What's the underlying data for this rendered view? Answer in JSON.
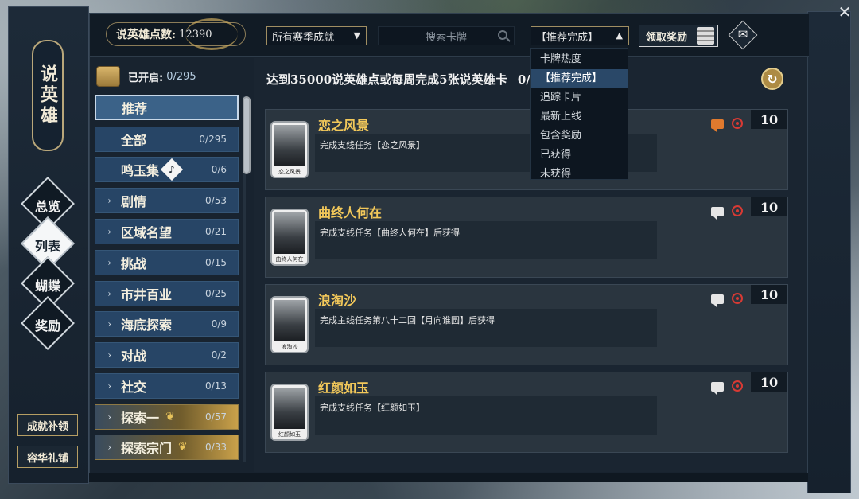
{
  "window": {
    "close_glyph": "✕"
  },
  "title": {
    "text": "说英雄"
  },
  "nav": {
    "items": [
      {
        "label": "总览",
        "active": false
      },
      {
        "label": "列表",
        "active": true
      },
      {
        "label": "蝴蝶",
        "active": false
      },
      {
        "label": "奖励",
        "active": false
      }
    ]
  },
  "side_buttons": {
    "makeup": "成就补领",
    "shop": "容华礼铺"
  },
  "topbar": {
    "points_label": "说英雄点数:",
    "points_value": "12390",
    "season_select": "所有赛季成就",
    "search_placeholder": "搜索卡牌",
    "sort_select": "【推荐完成】",
    "claim_button": "领取奖励"
  },
  "sidebar": {
    "opened_label": "已开启:",
    "opened_value": "0/295",
    "categories": [
      {
        "name": "推荐",
        "count": "",
        "chevron": false,
        "selected": true,
        "style": "normal"
      },
      {
        "name": "全部",
        "count": "0/295",
        "chevron": false,
        "selected": false,
        "style": "normal"
      },
      {
        "name": "鸣玉集",
        "count": "0/6",
        "chevron": false,
        "selected": false,
        "style": "normal",
        "badge": "music-icon"
      },
      {
        "name": "剧情",
        "count": "0/53",
        "chevron": true,
        "selected": false,
        "style": "normal"
      },
      {
        "name": "区域名望",
        "count": "0/21",
        "chevron": true,
        "selected": false,
        "style": "normal"
      },
      {
        "name": "挑战",
        "count": "0/15",
        "chevron": true,
        "selected": false,
        "style": "normal"
      },
      {
        "name": "市井百业",
        "count": "0/25",
        "chevron": true,
        "selected": false,
        "style": "normal"
      },
      {
        "name": "海底探索",
        "count": "0/9",
        "chevron": true,
        "selected": false,
        "style": "normal"
      },
      {
        "name": "对战",
        "count": "0/2",
        "chevron": true,
        "selected": false,
        "style": "normal"
      },
      {
        "name": "社交",
        "count": "0/13",
        "chevron": true,
        "selected": false,
        "style": "normal"
      },
      {
        "name": "探索一",
        "count": "0/57",
        "chevron": true,
        "selected": false,
        "style": "gold"
      },
      {
        "name": "探索宗门",
        "count": "0/33",
        "chevron": true,
        "selected": false,
        "style": "gold"
      }
    ]
  },
  "content": {
    "header": "达到35000说英雄点或每周完成5张说英雄卡",
    "header_suffix": "0/",
    "cards": [
      {
        "title": "恋之风景",
        "desc": "完成支线任务【恋之风景】",
        "thumb_caption": "恋之风景",
        "score": "10",
        "chat_alert": true
      },
      {
        "title": "曲终人何在",
        "desc": "完成支线任务【曲终人何在】后获得",
        "thumb_caption": "曲终人何在",
        "score": "10",
        "chat_alert": false
      },
      {
        "title": "浪淘沙",
        "desc": "完成主线任务第八十二回【月向谁圆】后获得",
        "thumb_caption": "浪淘沙",
        "score": "10",
        "chat_alert": false
      },
      {
        "title": "红颜如玉",
        "desc": "完成支线任务【红颜如玉】",
        "thumb_caption": "红颜如玉",
        "score": "10",
        "chat_alert": false
      }
    ]
  },
  "dropdown": {
    "options": [
      "卡牌热度",
      "【推荐完成】",
      "追踪卡片",
      "最新上线",
      "包含奖励",
      "已获得",
      "未获得"
    ],
    "selected_index": 1
  },
  "colors": {
    "accent_gold": "#f2c85a",
    "category_blue": "#274566",
    "selected_blue": "#3b6288",
    "alert_orange": "#e07a2e",
    "target_red": "#d83a34"
  }
}
